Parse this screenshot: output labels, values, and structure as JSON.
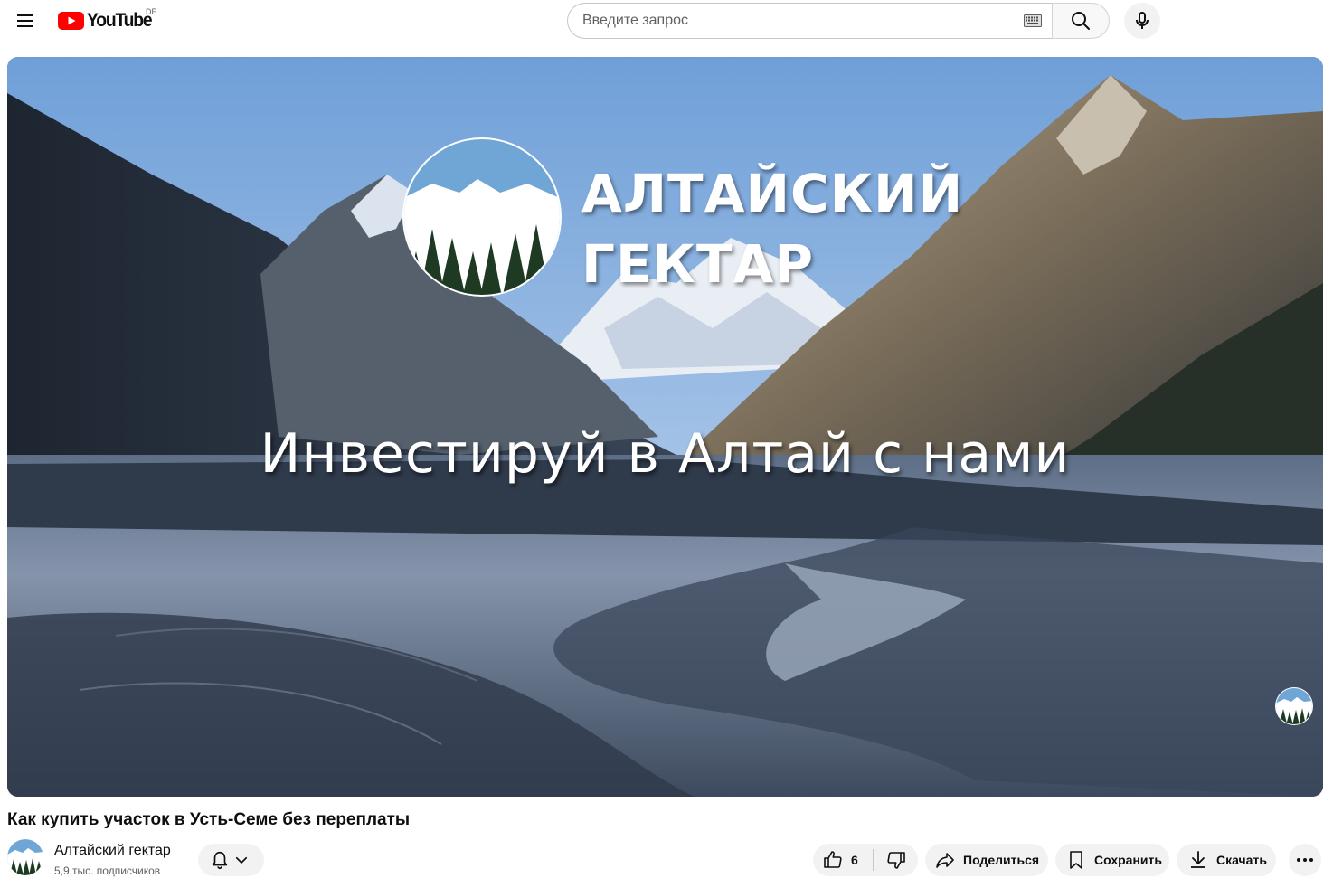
{
  "masthead": {
    "logo_text": "YouTube",
    "country_code": "DE",
    "search": {
      "placeholder": "Введите запрос",
      "value": ""
    }
  },
  "player": {
    "brand_line1": "АЛТАЙСКИЙ",
    "brand_line2": "ГЕКТАР",
    "slogan": "Инвестируй в Алтай с нами"
  },
  "video": {
    "title": "Как купить участок в Усть-Семе без переплаты"
  },
  "channel": {
    "name": "Алтайский гектар",
    "subscribers": "5,9 тыс. подписчиков"
  },
  "actions": {
    "like_count": "6",
    "share_label": "Поделиться",
    "save_label": "Сохранить",
    "download_label": "Скачать"
  },
  "colors": {
    "brand_red": "#ff0000",
    "pill_bg": "#f2f2f2",
    "text_primary": "#0f0f0f",
    "text_secondary": "#606060"
  },
  "icons": [
    "menu-icon",
    "youtube-logo-icon",
    "keyboard-icon",
    "search-icon",
    "microphone-icon",
    "bell-icon",
    "chevron-down-icon",
    "like-icon",
    "dislike-icon",
    "share-icon",
    "save-icon",
    "download-icon",
    "more-icon"
  ]
}
